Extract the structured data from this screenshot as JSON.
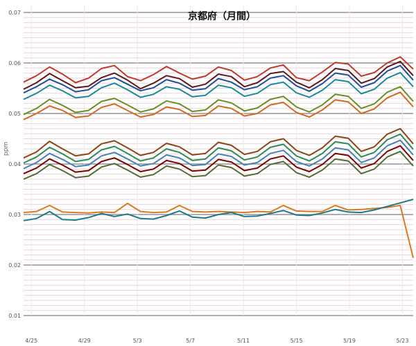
{
  "chart_data": {
    "type": "line",
    "title": "京都府（月間）",
    "xlabel": "",
    "ylabel": "ppm",
    "ylim": [
      0.01,
      0.07
    ],
    "yticks": [
      "0.01",
      "0.02",
      "0.03",
      "0.04",
      "0.05",
      "0.06",
      "0.07"
    ],
    "xticks": [
      "4/25",
      "4/29",
      "5/3",
      "5/7",
      "5/11",
      "5/15",
      "5/19",
      "5/23"
    ],
    "grid": true,
    "legend": "none",
    "x_range": [
      0,
      30
    ],
    "series": [
      {
        "color": "#c0392b",
        "values": [
          0.0562,
          0.0575,
          0.0592,
          0.0578,
          0.0561,
          0.057,
          0.0589,
          0.0595,
          0.0573,
          0.0565,
          0.0577,
          0.0593,
          0.058,
          0.0568,
          0.0574,
          0.0592,
          0.0585,
          0.0566,
          0.0573,
          0.059,
          0.0596,
          0.0571,
          0.0565,
          0.0582,
          0.0601,
          0.0598,
          0.0574,
          0.0581,
          0.06,
          0.0612,
          0.0588
        ]
      },
      {
        "color": "#5a1a1a",
        "values": [
          0.0548,
          0.0561,
          0.0579,
          0.0565,
          0.0551,
          0.0554,
          0.0571,
          0.058,
          0.0566,
          0.0549,
          0.056,
          0.0575,
          0.0569,
          0.0552,
          0.0558,
          0.0578,
          0.0573,
          0.0553,
          0.0561,
          0.0579,
          0.0583,
          0.0562,
          0.0551,
          0.0567,
          0.0589,
          0.0585,
          0.056,
          0.0569,
          0.0592,
          0.0603,
          0.0575
        ]
      },
      {
        "color": "#1f4e9c",
        "values": [
          0.0541,
          0.0553,
          0.0568,
          0.0557,
          0.0543,
          0.0547,
          0.0565,
          0.0571,
          0.0558,
          0.0545,
          0.0551,
          0.0567,
          0.056,
          0.0546,
          0.0549,
          0.0569,
          0.0562,
          0.0547,
          0.0553,
          0.057,
          0.0575,
          0.0555,
          0.0544,
          0.0559,
          0.058,
          0.0576,
          0.0552,
          0.0561,
          0.0584,
          0.0595,
          0.0566
        ]
      },
      {
        "color": "#1a8a9a",
        "values": [
          0.0528,
          0.054,
          0.0556,
          0.0545,
          0.0531,
          0.0534,
          0.0551,
          0.056,
          0.0547,
          0.0532,
          0.0538,
          0.0553,
          0.0548,
          0.0533,
          0.0536,
          0.0556,
          0.0551,
          0.0534,
          0.054,
          0.0557,
          0.0562,
          0.0541,
          0.0532,
          0.0546,
          0.0567,
          0.0563,
          0.0539,
          0.0548,
          0.057,
          0.0581,
          0.0553
        ]
      },
      {
        "color": "#6b8e23",
        "values": [
          0.0498,
          0.051,
          0.0528,
          0.0516,
          0.0502,
          0.0506,
          0.0524,
          0.053,
          0.0517,
          0.0503,
          0.0509,
          0.0525,
          0.0519,
          0.0504,
          0.0507,
          0.0527,
          0.0521,
          0.0505,
          0.0511,
          0.0528,
          0.0534,
          0.0513,
          0.0503,
          0.0517,
          0.0538,
          0.0534,
          0.051,
          0.0519,
          0.0542,
          0.0553,
          0.0524
        ]
      },
      {
        "color": "#d2691e",
        "values": [
          0.0488,
          0.05,
          0.0515,
          0.0506,
          0.0492,
          0.0495,
          0.0512,
          0.0519,
          0.0506,
          0.0493,
          0.0498,
          0.0513,
          0.0508,
          0.0494,
          0.0496,
          0.0515,
          0.051,
          0.0495,
          0.05,
          0.0517,
          0.0522,
          0.0502,
          0.0493,
          0.0507,
          0.0527,
          0.0523,
          0.05,
          0.0509,
          0.0531,
          0.0542,
          0.0513
        ]
      },
      {
        "color": "#8b4513",
        "values": [
          0.0412,
          0.0424,
          0.0445,
          0.043,
          0.0416,
          0.042,
          0.044,
          0.0446,
          0.0432,
          0.0417,
          0.0423,
          0.0441,
          0.0434,
          0.0418,
          0.0421,
          0.0443,
          0.0437,
          0.0419,
          0.0425,
          0.0444,
          0.045,
          0.0427,
          0.0417,
          0.0432,
          0.0455,
          0.0451,
          0.0425,
          0.0434,
          0.0459,
          0.047,
          0.044
        ]
      },
      {
        "color": "#2e8b57",
        "values": [
          0.0402,
          0.0414,
          0.0433,
          0.042,
          0.0405,
          0.0409,
          0.0428,
          0.0435,
          0.0421,
          0.0406,
          0.0412,
          0.043,
          0.0423,
          0.0407,
          0.041,
          0.0432,
          0.0426,
          0.0408,
          0.0414,
          0.0433,
          0.0439,
          0.0416,
          0.0406,
          0.0421,
          0.0444,
          0.044,
          0.0414,
          0.0423,
          0.0448,
          0.0459,
          0.0429
        ]
      },
      {
        "color": "#4682b4",
        "values": [
          0.0391,
          0.0403,
          0.0421,
          0.0409,
          0.0395,
          0.0398,
          0.0416,
          0.0423,
          0.041,
          0.0396,
          0.0401,
          0.0418,
          0.0412,
          0.0397,
          0.0399,
          0.042,
          0.0415,
          0.0398,
          0.0403,
          0.0421,
          0.0427,
          0.0405,
          0.0396,
          0.041,
          0.0432,
          0.0428,
          0.0403,
          0.0412,
          0.0436,
          0.0447,
          0.0418
        ]
      },
      {
        "color": "#800000",
        "values": [
          0.0381,
          0.0392,
          0.041,
          0.0398,
          0.0384,
          0.0387,
          0.0405,
          0.0412,
          0.0399,
          0.0385,
          0.039,
          0.0407,
          0.0401,
          0.0386,
          0.0388,
          0.0409,
          0.0404,
          0.0387,
          0.0392,
          0.041,
          0.0416,
          0.0394,
          0.0385,
          0.0399,
          0.0421,
          0.0417,
          0.0392,
          0.0401,
          0.0425,
          0.0436,
          0.0407
        ]
      },
      {
        "color": "#556b2f",
        "values": [
          0.037,
          0.0381,
          0.0399,
          0.0387,
          0.0373,
          0.0376,
          0.0394,
          0.0401,
          0.0388,
          0.0374,
          0.0379,
          0.0396,
          0.039,
          0.0375,
          0.0377,
          0.0398,
          0.0393,
          0.0376,
          0.0381,
          0.0399,
          0.0405,
          0.0383,
          0.0374,
          0.0388,
          0.041,
          0.0406,
          0.0381,
          0.039,
          0.0414,
          0.0425,
          0.0396
        ]
      },
      {
        "color": "#d97a1e",
        "values": [
          0.0304,
          0.0306,
          0.0318,
          0.0305,
          0.0304,
          0.0303,
          0.0305,
          0.0304,
          0.0322,
          0.0306,
          0.0304,
          0.0305,
          0.0318,
          0.0306,
          0.0305,
          0.0306,
          0.0305,
          0.0304,
          0.0306,
          0.0305,
          0.0318,
          0.0307,
          0.0306,
          0.0306,
          0.0318,
          0.0309,
          0.031,
          0.0312,
          0.0314,
          0.0318,
          0.0214
        ]
      },
      {
        "color": "#1a7a8a",
        "values": [
          0.0288,
          0.0292,
          0.0306,
          0.029,
          0.0289,
          0.0294,
          0.0302,
          0.0296,
          0.0301,
          0.0292,
          0.0291,
          0.0298,
          0.0307,
          0.0295,
          0.0293,
          0.03,
          0.0304,
          0.0296,
          0.0297,
          0.0302,
          0.0308,
          0.0299,
          0.0298,
          0.0303,
          0.031,
          0.0305,
          0.0304,
          0.0309,
          0.0316,
          0.0323,
          0.033
        ]
      }
    ]
  }
}
